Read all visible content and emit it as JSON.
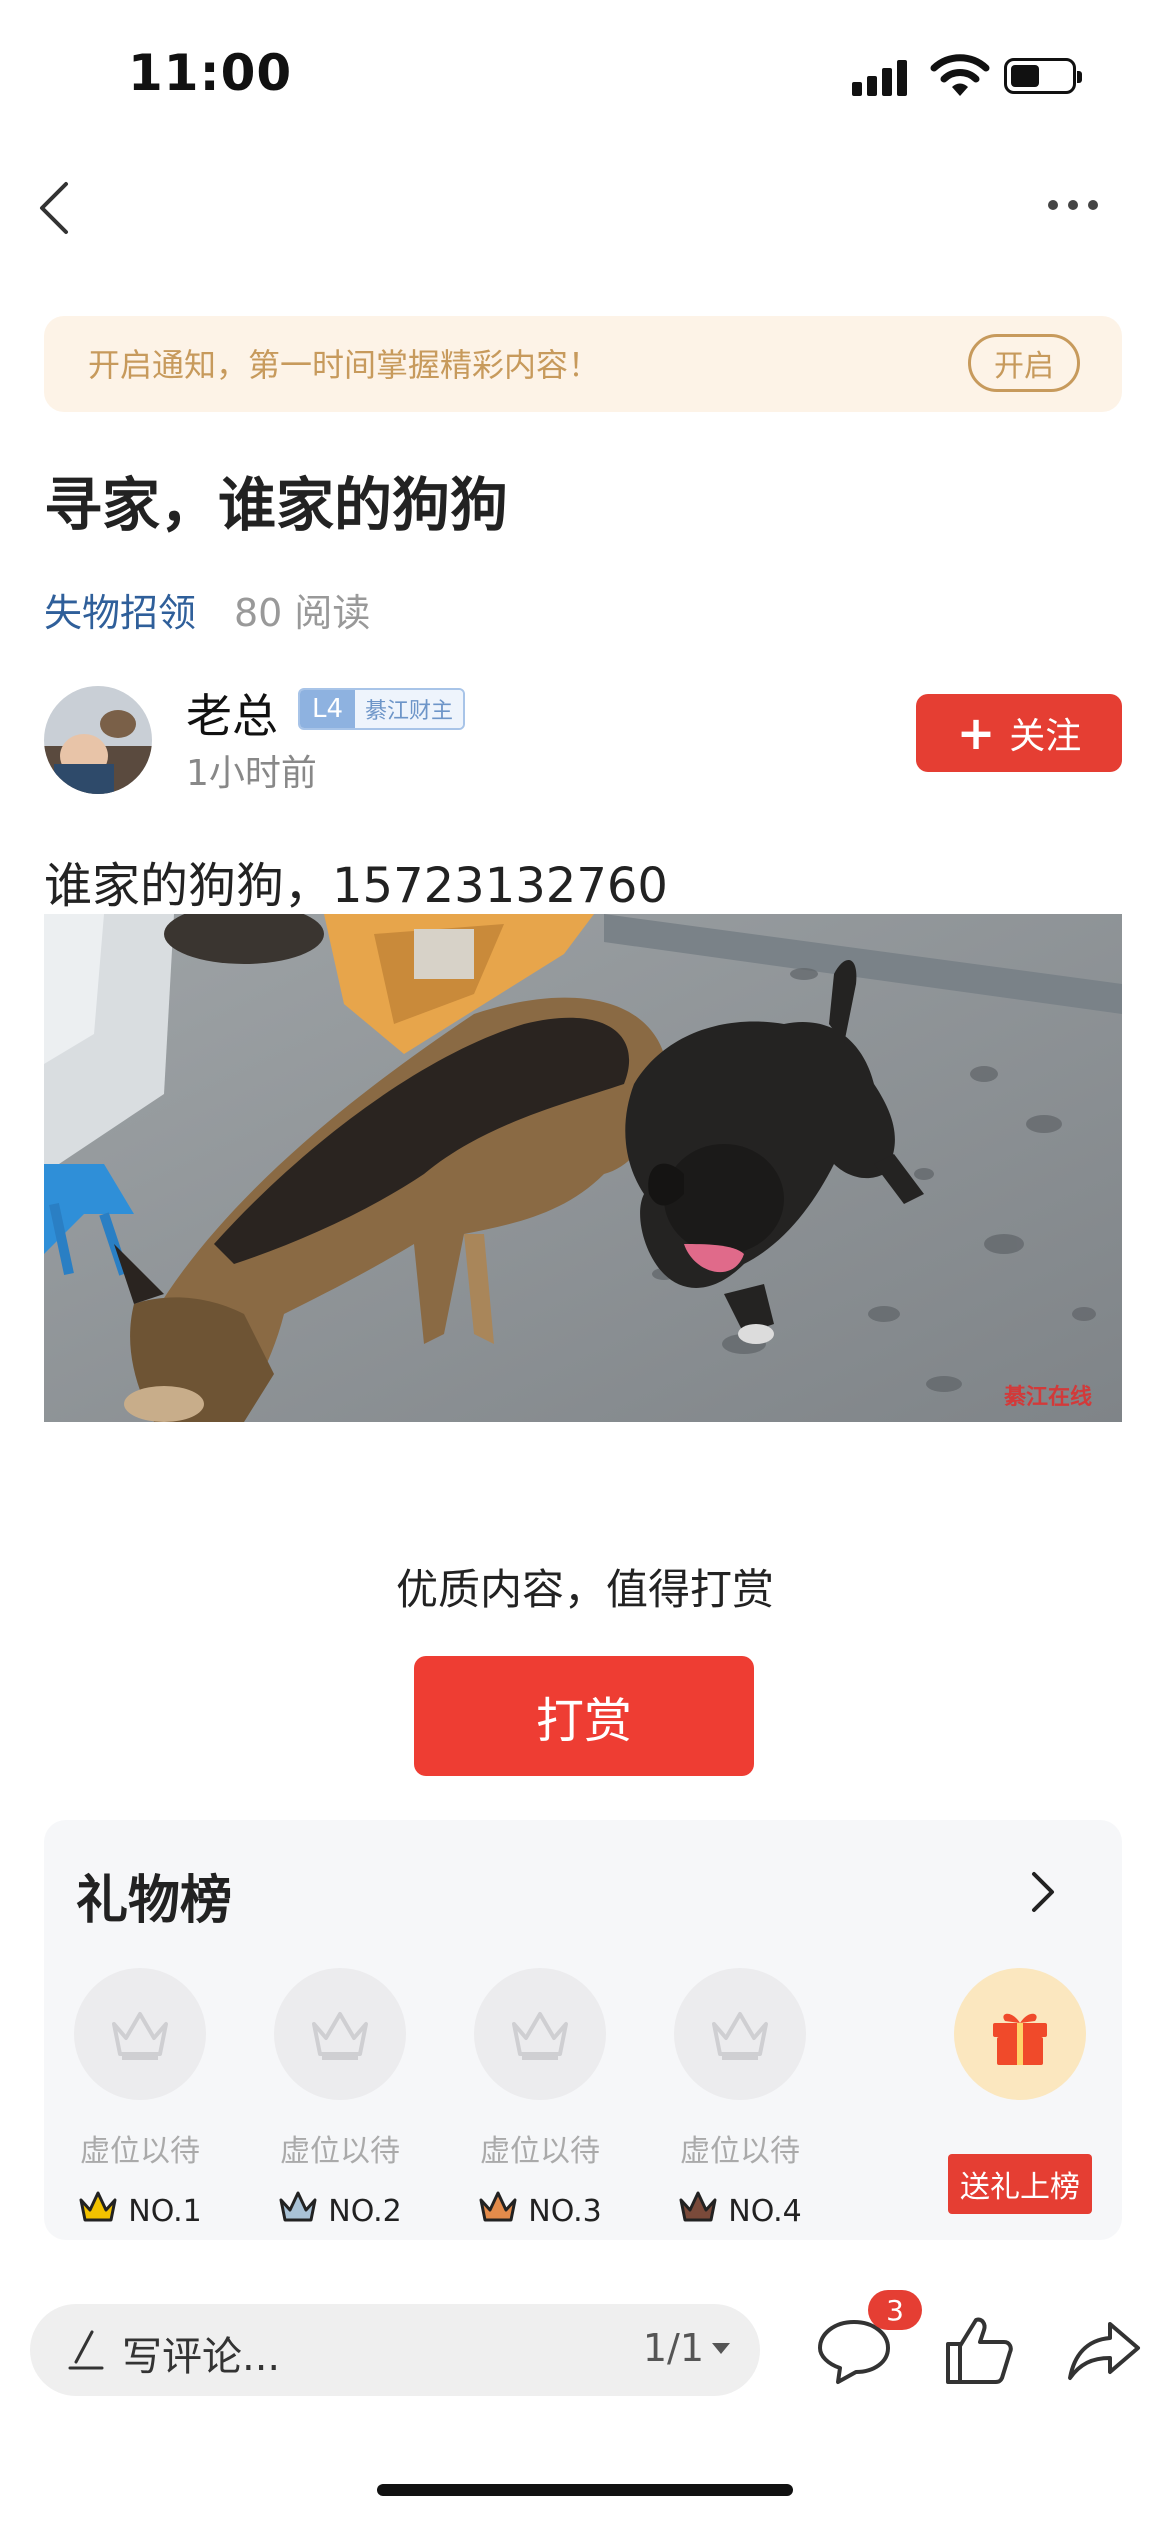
{
  "status_bar": {
    "time": "11:00"
  },
  "notify": {
    "text": "开启通知，第一时间掌握精彩内容！",
    "button": "开启"
  },
  "post": {
    "title": "寻家，谁家的狗狗",
    "category": "失物招领",
    "reads": "80 阅读",
    "content": "谁家的狗狗，15723132760",
    "watermark": "綦江在线"
  },
  "author": {
    "name": "老总",
    "level": "L4",
    "tag": "綦江财主",
    "time": "1小时前",
    "follow_label": "关注"
  },
  "reward": {
    "tip": "优质内容，值得打赏",
    "button": "打赏"
  },
  "gift_board": {
    "title": "礼物榜",
    "slots": [
      {
        "label": "虚位以待",
        "rank": "NO.1",
        "crown_color": "#f2c200"
      },
      {
        "label": "虚位以待",
        "rank": "NO.2",
        "crown_color": "#a9c2d6"
      },
      {
        "label": "虚位以待",
        "rank": "NO.3",
        "crown_color": "#e38b4b"
      },
      {
        "label": "虚位以待",
        "rank": "NO.4",
        "crown_color": "#7a4a3a"
      }
    ],
    "send_label": "送礼上榜"
  },
  "bottom_bar": {
    "comment_placeholder": "写评论...",
    "page": "1/1",
    "comment_count": "3"
  },
  "colors": {
    "accent": "#e53e33",
    "link": "#2f5f9a",
    "notify_bg": "#fdf3e7",
    "notify_text": "#c79a5c"
  }
}
